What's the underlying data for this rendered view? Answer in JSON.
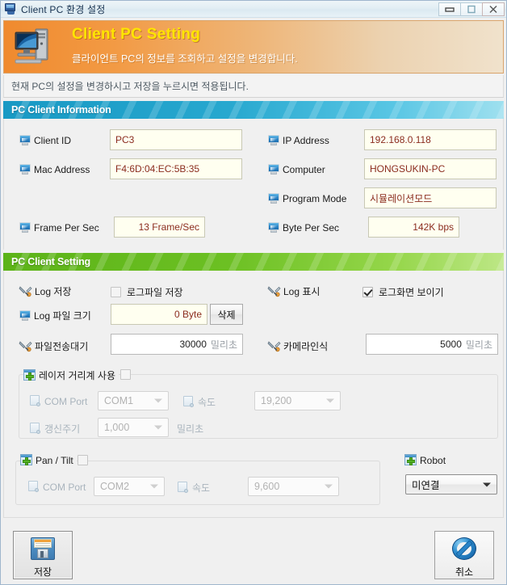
{
  "window": {
    "title": "Client PC 환경 설정",
    "icon": "monitor-icon",
    "controls": {
      "minimize": "minimize-icon",
      "maximize": "maximize-icon",
      "close": "close-icon"
    }
  },
  "banner": {
    "title": "Client PC Setting",
    "subtitle": "클라이언트 PC의 정보를 조회하고 설정을 변경합니다.",
    "icon": "desktop-computer-icon",
    "accent_color": "#f08a2e",
    "title_color": "#ffe500"
  },
  "hint": {
    "text": "현재 PC의 설정을 변경하시고 저장을 누르시면 적용됩니다."
  },
  "sections": {
    "info": {
      "title": "PC Client Information",
      "color": "#1899c4"
    },
    "setting": {
      "title": "PC Client Setting",
      "color": "#5cb318"
    }
  },
  "info_fields": {
    "client_id": {
      "label": "Client ID",
      "value": "PC3"
    },
    "mac_address": {
      "label": "Mac Address",
      "value": "F4:6D:04:EC:5B:35"
    },
    "frame_per_sec": {
      "label": "Frame Per Sec",
      "value": "13 Frame/Sec"
    },
    "ip_address": {
      "label": "IP Address",
      "value": "192.168.0.118"
    },
    "computer": {
      "label": "Computer",
      "value": "HONGSUKIN-PC"
    },
    "program_mode": {
      "label": "Program Mode",
      "value": "시뮬레이션모드"
    },
    "byte_per_sec": {
      "label": "Byte Per Sec",
      "value": "142K bps"
    }
  },
  "setting_fields": {
    "log_save": {
      "label": "Log 저장",
      "checkbox_label": "로그파일 저장",
      "checked": false
    },
    "log_display": {
      "label": "Log 표시",
      "checkbox_label": "로그화면 보이기",
      "checked": true
    },
    "log_file_size": {
      "label": "Log 파일 크기",
      "value": "0 Byte",
      "delete_button": "삭제"
    },
    "file_transfer_wait": {
      "label": "파일전송대기",
      "value": "30000",
      "unit": "밀리초"
    },
    "camera_recognition": {
      "label": "카메라인식",
      "value": "5000",
      "unit": "밀리초"
    }
  },
  "laser_group": {
    "title": "레이저 거리계 사용",
    "enabled": false,
    "com_port": {
      "label": "COM Port",
      "value": "COM1"
    },
    "speed": {
      "label": "속도",
      "value": "19,200"
    },
    "refresh": {
      "label": "갱신주기",
      "value": "1,000",
      "unit": "밀리초"
    }
  },
  "pantilt_group": {
    "title": "Pan / Tilt",
    "enabled": false,
    "com_port": {
      "label": "COM Port",
      "value": "COM2"
    },
    "speed": {
      "label": "속도",
      "value": "9,600"
    }
  },
  "robot": {
    "title": "Robot",
    "status": "미연결"
  },
  "footer": {
    "save_button": "저장",
    "cancel_button": "취소"
  }
}
